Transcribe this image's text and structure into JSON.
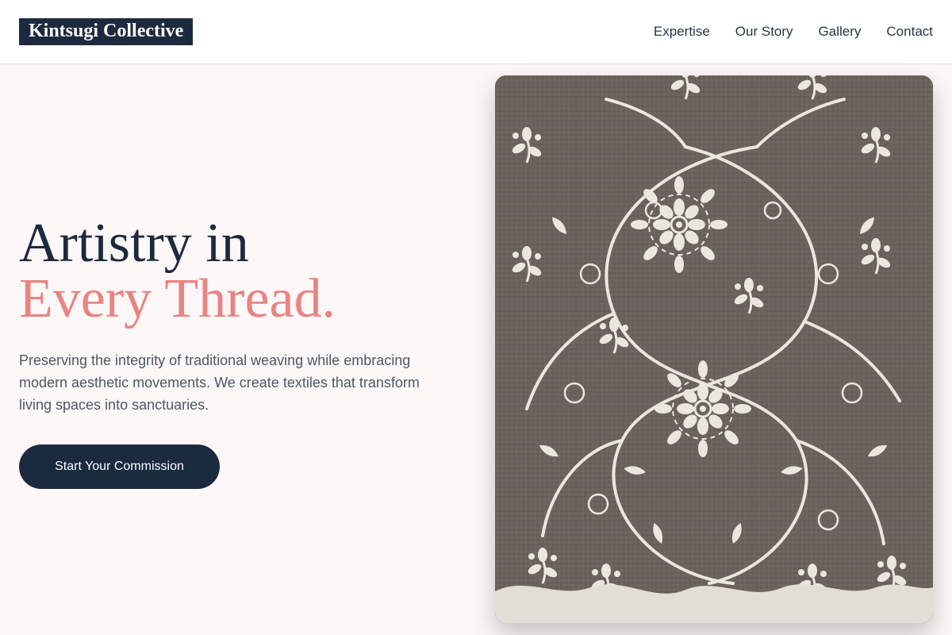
{
  "brand": {
    "name": "Kintsugi Collective"
  },
  "nav": {
    "links": [
      "Expertise",
      "Our Story",
      "Gallery",
      "Contact"
    ]
  },
  "hero": {
    "title_line1": "Artistry in",
    "title_line2": "Every Thread.",
    "description": "Preserving the integrity of traditional weaving while embracing modern aesthetic movements. We create textiles that transform living spaces into sanctuaries.",
    "cta_label": "Start Your Commission",
    "image": {
      "subject": "floral-embroidered-textile",
      "fabric_color": "#6b645d",
      "thread_color": "#ebe7df"
    }
  },
  "colors": {
    "primary": "#1c2a3f",
    "accent": "#e88482",
    "background": "#fdf7f7"
  }
}
